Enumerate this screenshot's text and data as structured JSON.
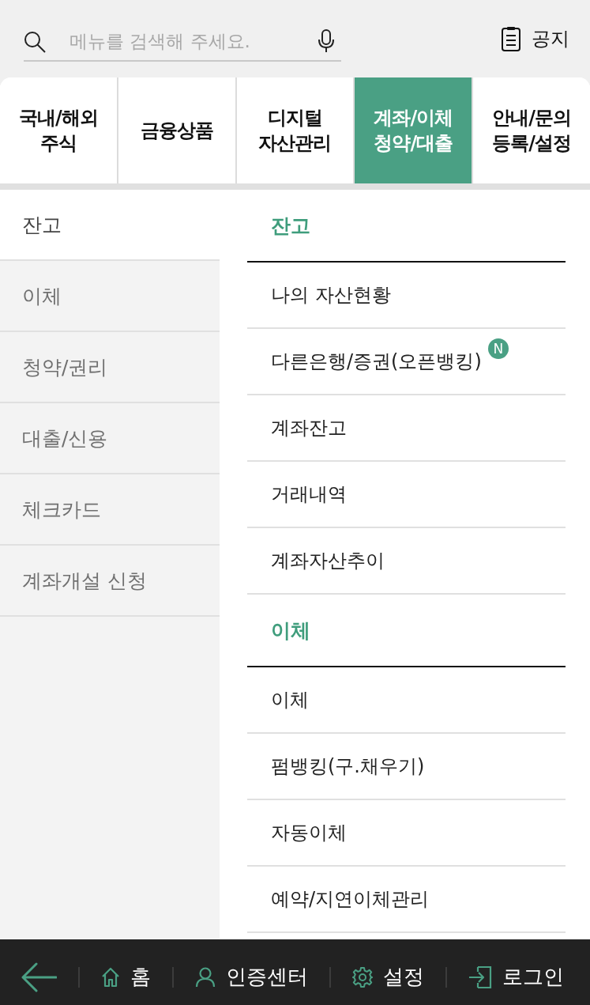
{
  "search": {
    "placeholder": "메뉴를 검색해 주세요."
  },
  "notice": {
    "label": "공지"
  },
  "tabs": [
    {
      "lines": [
        "국내/해외",
        "주식"
      ],
      "selected": false
    },
    {
      "lines": [
        "금융상품"
      ],
      "selected": false
    },
    {
      "lines": [
        "디지털",
        "자산관리"
      ],
      "selected": false
    },
    {
      "lines": [
        "계좌/이체",
        "청약/대출"
      ],
      "selected": true
    },
    {
      "lines": [
        "안내/문의",
        "등록/설정"
      ],
      "selected": false
    }
  ],
  "sidebar": {
    "items": [
      {
        "label": "잔고",
        "selected": true
      },
      {
        "label": "이체",
        "selected": false
      },
      {
        "label": "청약/권리",
        "selected": false
      },
      {
        "label": "대출/신용",
        "selected": false
      },
      {
        "label": "체크카드",
        "selected": false
      },
      {
        "label": "계좌개설 신청",
        "selected": false
      }
    ]
  },
  "sections": [
    {
      "title": "잔고",
      "items": [
        {
          "label": "나의 자산현황"
        },
        {
          "label": "다른은행/증권(오픈뱅킹)",
          "badge": "N"
        },
        {
          "label": "계좌잔고"
        },
        {
          "label": "거래내역"
        },
        {
          "label": "계좌자산추이"
        }
      ]
    },
    {
      "title": "이체",
      "items": [
        {
          "label": "이체"
        },
        {
          "label": "펌뱅킹(구.채우기)"
        },
        {
          "label": "자동이체"
        },
        {
          "label": "예약/지연이체관리"
        }
      ]
    }
  ],
  "bottom_nav": {
    "items": [
      {
        "label": "홈"
      },
      {
        "label": "인증센터"
      },
      {
        "label": "설정"
      },
      {
        "label": "로그인"
      }
    ]
  }
}
